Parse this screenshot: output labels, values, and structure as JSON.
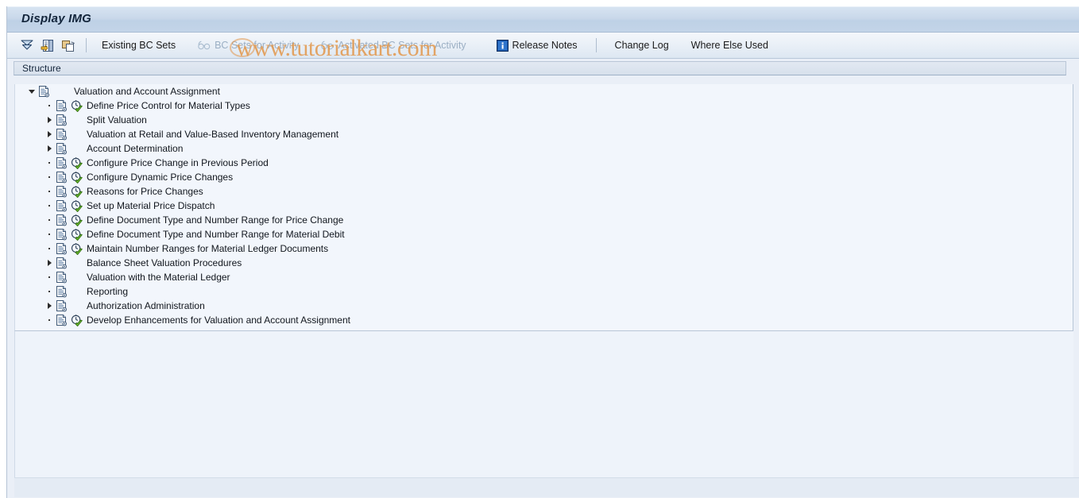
{
  "window": {
    "title": "Display IMG"
  },
  "toolbar": {
    "icons": [
      {
        "name": "collapse-all-icon",
        "glyph": "expand-collapse"
      },
      {
        "name": "select-subtree-icon",
        "glyph": "list-select"
      },
      {
        "name": "copy-icon",
        "glyph": "copy"
      }
    ],
    "buttons": [
      {
        "name": "existing-bc-sets-button",
        "label": "Existing BC Sets",
        "disabled": false,
        "icon": null
      },
      {
        "name": "bc-sets-for-activity-button",
        "label": "BC Sets for Activity",
        "disabled": true,
        "icon": "glasses-icon"
      },
      {
        "name": "activated-bc-sets-for-activity-button",
        "label": "Activated BC Sets for Activity",
        "disabled": true,
        "icon": "glasses-icon"
      },
      {
        "name": "release-notes-button",
        "label": "Release Notes",
        "disabled": false,
        "icon": "info-icon"
      },
      {
        "name": "change-log-button",
        "label": "Change Log",
        "disabled": false,
        "icon": null
      },
      {
        "name": "where-else-used-button",
        "label": "Where Else Used",
        "disabled": false,
        "icon": null
      }
    ]
  },
  "column_header": {
    "label": "Structure"
  },
  "tree": [
    {
      "label": "Valuation and Account Assignment",
      "level": 0,
      "state": "expanded",
      "has_activity": false
    },
    {
      "label": "Define Price Control for Material Types",
      "level": 1,
      "state": "leaf",
      "has_activity": true
    },
    {
      "label": "Split Valuation",
      "level": 1,
      "state": "collapsed",
      "has_activity": false
    },
    {
      "label": "Valuation at Retail and Value-Based Inventory Management",
      "level": 1,
      "state": "collapsed",
      "has_activity": false
    },
    {
      "label": "Account Determination",
      "level": 1,
      "state": "collapsed",
      "has_activity": false
    },
    {
      "label": "Configure Price Change in Previous Period",
      "level": 1,
      "state": "leaf",
      "has_activity": true
    },
    {
      "label": "Configure Dynamic Price Changes",
      "level": 1,
      "state": "leaf",
      "has_activity": true
    },
    {
      "label": "Reasons for Price Changes",
      "level": 1,
      "state": "leaf",
      "has_activity": true
    },
    {
      "label": "Set up Material Price Dispatch",
      "level": 1,
      "state": "leaf",
      "has_activity": true
    },
    {
      "label": "Define Document Type and Number Range for Price Change",
      "level": 1,
      "state": "leaf",
      "has_activity": true
    },
    {
      "label": "Define Document Type and Number Range for Material Debit",
      "level": 1,
      "state": "leaf",
      "has_activity": true
    },
    {
      "label": "Maintain Number Ranges for Material Ledger Documents",
      "level": 1,
      "state": "leaf",
      "has_activity": true
    },
    {
      "label": "Balance Sheet Valuation Procedures",
      "level": 1,
      "state": "collapsed",
      "has_activity": false
    },
    {
      "label": "Valuation with the Material Ledger",
      "level": 1,
      "state": "leaf",
      "has_activity": false
    },
    {
      "label": "Reporting",
      "level": 1,
      "state": "leaf",
      "has_activity": false
    },
    {
      "label": "Authorization Administration",
      "level": 1,
      "state": "collapsed",
      "has_activity": false
    },
    {
      "label": "Develop Enhancements for Valuation and Account Assignment",
      "level": 1,
      "state": "leaf",
      "has_activity": true
    }
  ],
  "watermark": {
    "text": "www.tutorialkart.com"
  },
  "colors": {
    "title_bar": "#c9d8ea",
    "toolbar": "#e7eef6",
    "tree_background": "#f2f6fc",
    "disabled_text": "#9bafc4",
    "accent_blue": "#1a4f8a",
    "watermark": "#e2964a"
  }
}
